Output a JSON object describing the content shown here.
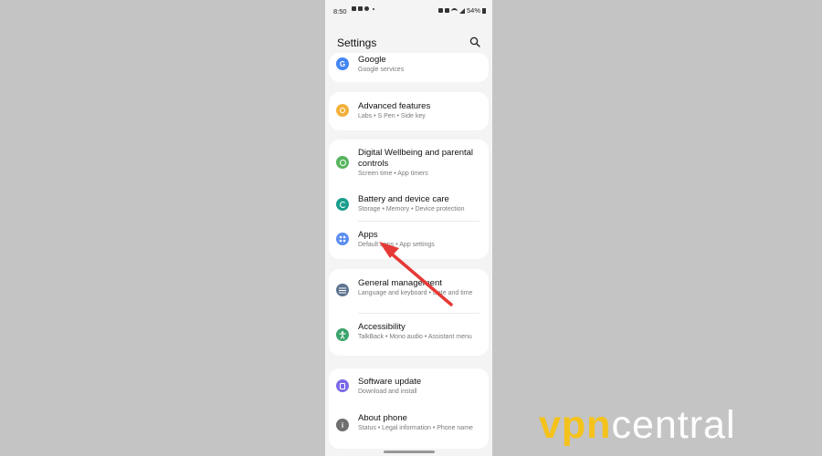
{
  "status_bar": {
    "time": "8:50",
    "battery": "54%"
  },
  "header": {
    "title": "Settings"
  },
  "items": {
    "google": {
      "title": "Google",
      "subtitle": "Google services",
      "icon": "google-icon",
      "color": "#4285f4"
    },
    "advanced": {
      "title": "Advanced features",
      "subtitle": "Labs • S Pen • Side key",
      "icon": "star-gear-icon",
      "color": "#f3b13a"
    },
    "wellbeing": {
      "title": "Digital Wellbeing and parental controls",
      "subtitle": "Screen time • App timers",
      "icon": "wellbeing-icon",
      "color": "#56b55e"
    },
    "battery": {
      "title": "Battery and device care",
      "subtitle": "Storage • Memory • Device protection",
      "icon": "device-care-icon",
      "color": "#1a9e8e"
    },
    "apps": {
      "title": "Apps",
      "subtitle": "Default apps • App settings",
      "icon": "apps-grid-icon",
      "color": "#5b8ef0"
    },
    "general": {
      "title": "General management",
      "subtitle": "Language and keyboard • Date and time",
      "icon": "sliders-icon",
      "color": "#5d7390"
    },
    "accessibility": {
      "title": "Accessibility",
      "subtitle": "TalkBack • Mono audio • Assistant menu",
      "icon": "accessibility-icon",
      "color": "#3aa36b"
    },
    "update": {
      "title": "Software update",
      "subtitle": "Download and install",
      "icon": "update-icon",
      "color": "#7b6be8"
    },
    "about": {
      "title": "About phone",
      "subtitle": "Status • Legal information • Phone name",
      "icon": "info-icon",
      "color": "#6f6f6f"
    }
  },
  "watermark": {
    "brand_a": "vpn",
    "brand_b": "central",
    "accent": "#f5c21b"
  },
  "annotation": {
    "arrow_color": "#e53935"
  }
}
